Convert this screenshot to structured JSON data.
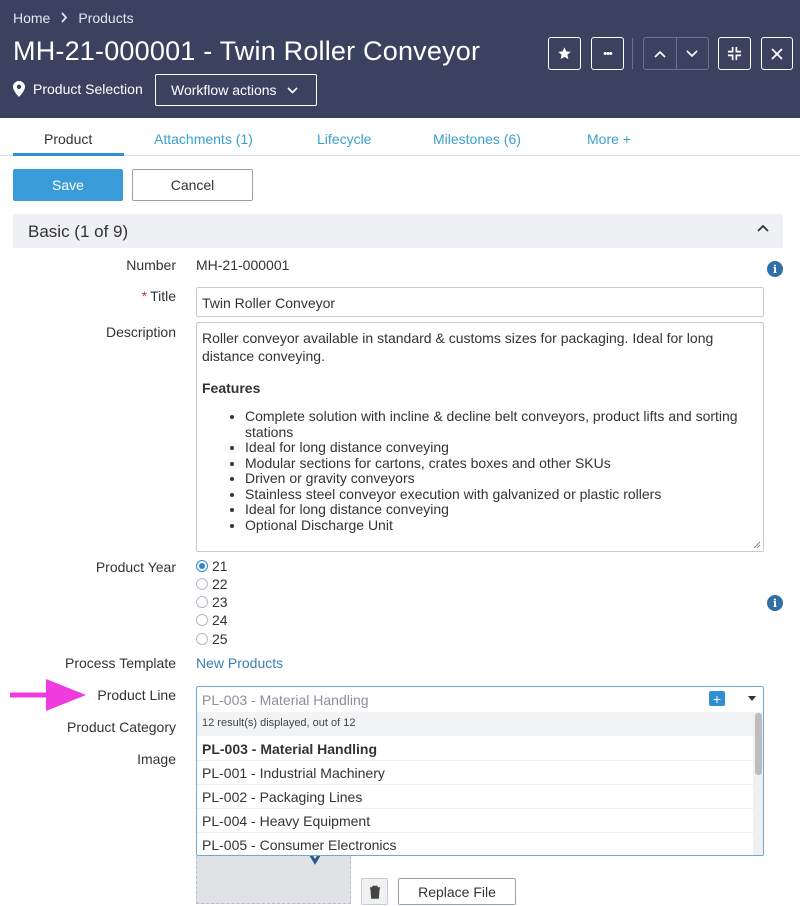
{
  "header": {
    "breadcrumb": [
      "Home",
      "Products"
    ],
    "title": "MH-21-000001 - Twin Roller Conveyor",
    "product_selection": "Product Selection",
    "workflow_actions": "Workflow actions",
    "more_glyph": "•••",
    "icons": [
      "star-icon",
      "more-icon",
      "chevron-up-icon",
      "chevron-down-icon",
      "minimize-icon",
      "close-icon",
      "map-pin-icon"
    ]
  },
  "tabs": [
    {
      "label": "Product",
      "active": true
    },
    {
      "label": "Attachments (1)"
    },
    {
      "label": "Lifecycle"
    },
    {
      "label": "Milestones (6)"
    },
    {
      "label": "More +"
    }
  ],
  "actions": {
    "save": "Save",
    "cancel": "Cancel"
  },
  "section": {
    "title": "Basic (1 of 9)"
  },
  "fields": {
    "number": {
      "label": "Number",
      "value": "MH-21-000001"
    },
    "title": {
      "label": "Title",
      "required_mark": "*",
      "value": "Twin Roller Conveyor"
    },
    "description": {
      "label": "Description",
      "intro": "Roller conveyor available in standard & customs sizes for packaging. Ideal for long distance conveying.",
      "features_heading": "Features",
      "features": [
        "Complete solution with incline & decline belt conveyors, product lifts and sorting stations",
        "Ideal for long distance conveying",
        "Modular sections for cartons, crates boxes and other SKUs",
        "Driven or gravity conveyors",
        "Stainless steel conveyor execution with galvanized or plastic rollers",
        "Ideal for long distance conveying",
        "Optional Discharge Unit"
      ]
    },
    "product_year": {
      "label": "Product Year",
      "options": [
        "21",
        "22",
        "23",
        "24",
        "25"
      ],
      "selected": "21"
    },
    "process_template": {
      "label": "Process Template",
      "value": "New Products"
    },
    "product_line": {
      "label": "Product Line",
      "placeholder": "PL-003 - Material Handling",
      "count_text": "12 result(s) displayed, out of 12",
      "plus": "+",
      "options": [
        "PL-003 - Material Handling",
        "PL-001 - Industrial Machinery",
        "PL-002 - Packaging Lines",
        "PL-004 - Heavy Equipment",
        "PL-005 - Consumer Electronics"
      ],
      "selected": "PL-003 - Material Handling"
    },
    "product_category": {
      "label": "Product Category"
    },
    "image": {
      "label": "Image",
      "replace_label": "Replace File"
    }
  },
  "info_glyph": "i",
  "colors": {
    "header_bg": "#3b4260",
    "accent": "#3a9bd9",
    "link": "#3a9fcf",
    "annotation_arrow": "#f03cde",
    "required": "#d0342c"
  }
}
